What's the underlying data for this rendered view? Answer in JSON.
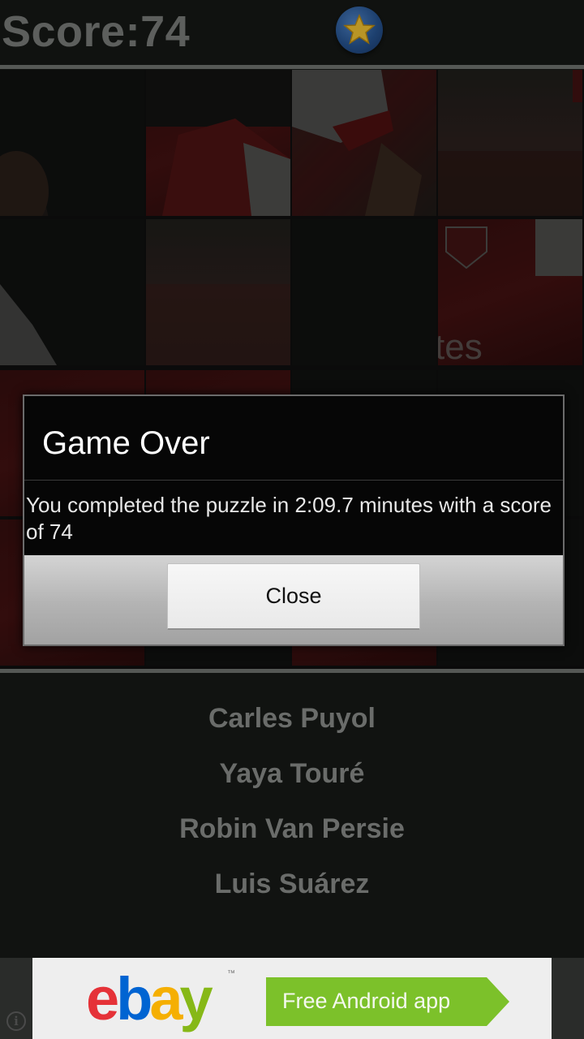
{
  "header": {
    "score_text": "Score:74"
  },
  "dialog": {
    "title": "Game Over",
    "message": "You completed the puzzle in 2:09.7 minutes with a score of 74",
    "close_label": "Close"
  },
  "answers": [
    "Carles Puyol",
    "Yaya Touré",
    "Robin Van Persie",
    "Luis Suárez"
  ],
  "ad": {
    "brand": "ebay",
    "cta": "Free Android app"
  },
  "icons": {
    "star": "star-icon",
    "info": "info-icon"
  },
  "colors": {
    "score_text": "#5d5f5d",
    "star_button": "#2a5ea6",
    "star": "#f2c12e",
    "answer_text": "#6a6c6a",
    "dialog_bg": "#060606",
    "ad_cta": "#7cc12a"
  }
}
